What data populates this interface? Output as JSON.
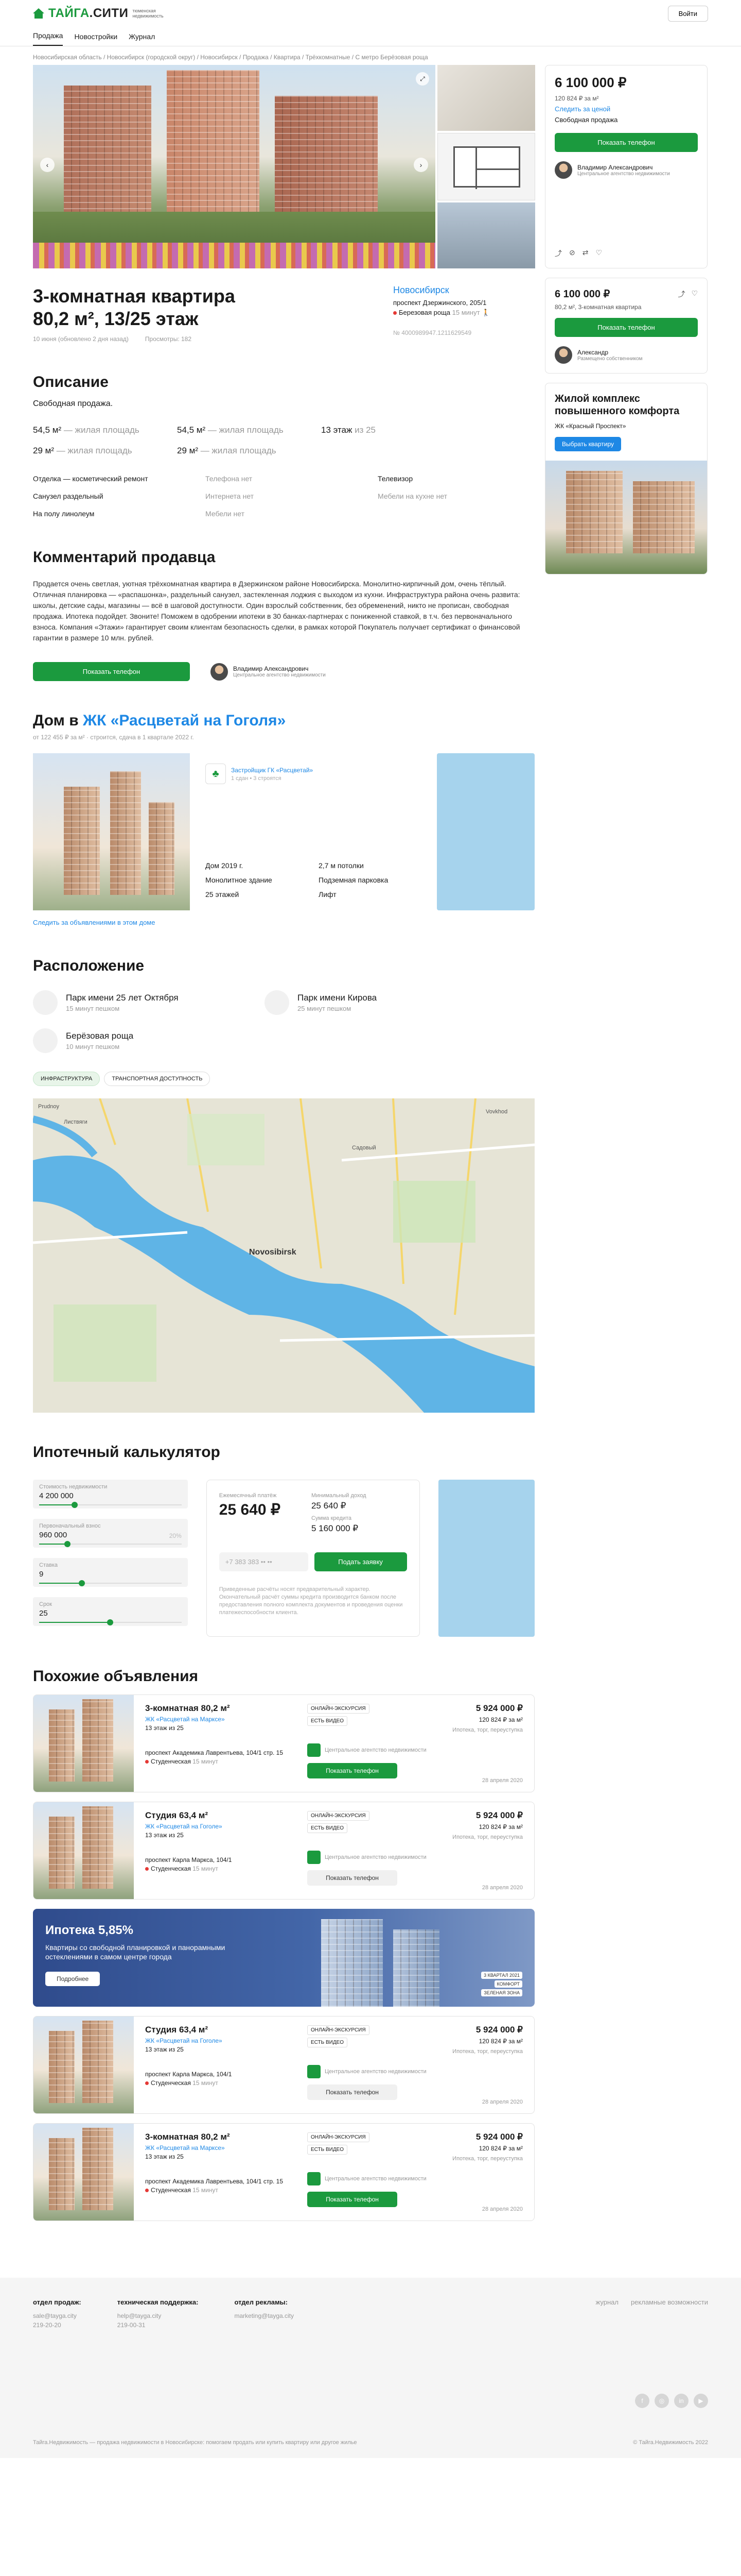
{
  "header": {
    "brand_main": "ТАЙГА",
    "brand_dot": ".СИТИ",
    "brand_sub": "тюменская недвижимость",
    "login": "Войти",
    "nav": [
      "Продажа",
      "Новостройки",
      "Журнал"
    ]
  },
  "breadcrumbs": "Новосибирская область / Новосибирск (городской округ) / Новосибирск / Продажа / Квартира / Трёхкомнатные / С метро Берёзовая роща",
  "price_box": {
    "price": "6 100 000 ₽",
    "ppm": "120 824 ₽ за м²",
    "watch": "Следить за ценой",
    "sale_type": "Свободная продажа",
    "show_phone": "Показать телефон",
    "agent_name": "Владимир Александрович",
    "agent_role": "Центральное агентство недвижимости",
    "icons": [
      "share-icon",
      "block-icon",
      "compare-icon",
      "heart-icon"
    ]
  },
  "listing": {
    "title_line1": "3-комнатная квартира",
    "title_line2": "80,2 м², 13/25 этаж",
    "date": "10 июня (обновлено 2 дня назад)",
    "views": "Просмотры: 182",
    "city": "Новосибирск",
    "street": "проспект Дзержинского, 205/1",
    "metro": "Березовая роща",
    "metro_time": "15 минут",
    "ad_number": "№ 4000989947.1211629549"
  },
  "description": {
    "heading": "Описание",
    "sale": "Свободная продажа.",
    "params": [
      {
        "value": "54,5 м²",
        "label": " — жилая площадь"
      },
      {
        "value": "54,5 м²",
        "label": " — жилая площадь"
      },
      {
        "value": "13 этаж",
        "label": " из 25"
      },
      {
        "value": "29 м²",
        "label": " — жилая площадь"
      },
      {
        "value": "29 м²",
        "label": " — жилая площадь"
      },
      {
        "value": "",
        "label": ""
      }
    ],
    "features": [
      "Отделка — косметический ремонт",
      "Телефона нет",
      "Телевизор",
      "Санузел раздельный",
      "Интернета нет",
      "Мебели на кухне нет",
      "На полу линолеум",
      "Мебели нет",
      ""
    ]
  },
  "comment": {
    "heading": "Комментарий продавца",
    "text": "Продается очень светлая, уютная трёхкомнатная квартира в Дзержинском районе Новосибирска. Монолитно-кирпичный дом, очень тёплый. Отличная планировка — «распашонка», раздельный санузел, застекленная лоджия с выходом из кухни. Инфраструктура района очень развита: школы, детские сады, магазины — всё в шаговой доступности. Один взрослый собственник, без обременений, никто не прописан, свободная продажа. Ипотека подойдет. Звоните! Поможем в одобрении ипотеки в 30 банках-партнерах с пониженной ставкой, в т.ч. без первоначального взноса. Компания «Этажи» гарантирует своим клиентам безопасность сделки, в рамках которой Покупатель получает сертификат о финансовой гарантии в размере 10 млн. рублей.",
    "show_phone": "Показать телефон",
    "agent_name": "Владимир Александрович",
    "agent_role": "Центральное агентство недвижимости"
  },
  "house": {
    "heading_prefix": "Дом в ",
    "heading_link": "ЖК «Расцветай на Гоголя»",
    "sub": "от 122 455 ₽ за м²  ·  строится, сдача в 1 квартале 2022 г.",
    "developer": "Застройщик ГК «Расцветай»",
    "developer_sub": "1 сдан • 3 строятся",
    "facts": [
      "Дом 2019 г.",
      "2,7 м потолки",
      "Монолитное здание",
      "Подземная парковка",
      "25 этажей",
      "Лифт"
    ],
    "follow": "Следить за объявлениями в этом доме"
  },
  "location": {
    "heading": "Расположение",
    "places": [
      {
        "title": "Парк имени 25 лет Октября",
        "time": "15 минут пешком"
      },
      {
        "title": "Парк имени Кирова",
        "time": "25 минут пешком"
      },
      {
        "title": "Берёзовая роща",
        "time": "10 минут пешком"
      }
    ],
    "pills": [
      "ИНФРАСТРУКТУРА",
      "ТРАНСПОРТНАЯ ДОСТУПНОСТЬ"
    ],
    "map_city": "Novosibirsk",
    "map_labels": [
      "Vovkhod",
      "Prudnoy",
      "Листвяги",
      "Садовый"
    ]
  },
  "mortgage": {
    "heading": "Ипотечный калькулятор",
    "fields": [
      {
        "label": "Стоимость недвижимости",
        "value": "4 200 000",
        "hint": "",
        "fill": 0.25
      },
      {
        "label": "Первоначальный взнос",
        "value": "960 000",
        "hint": "20%",
        "fill": 0.2
      },
      {
        "label": "Ставка",
        "value": "9",
        "hint": "",
        "fill": 0.3
      },
      {
        "label": "Срок",
        "value": "25",
        "hint": "",
        "fill": 0.5
      }
    ],
    "monthly_label": "Ежемесячный платёж",
    "monthly": "25 640 ₽",
    "income_label": "Минимальный доход",
    "income": "25 640 ₽",
    "credit_label": "Сумма кредита",
    "credit": "5 160 000 ₽",
    "phone_placeholder": "+7 383 383 •• ••",
    "submit": "Подать заявку",
    "note": "Приведенные расчёты носят предварительный характер. Окончательный расчёт суммы кредита производится банком после предоставления полного комплекта документов и проведения оценки платежеспособности клиента."
  },
  "similar": {
    "heading": "Похожие объявления",
    "items": [
      {
        "title": "3-комнатная 80,2 м²",
        "jk": "ЖК «Расцветай на Марксе»",
        "floor": "13 этаж из 25",
        "addr": "проспект Академика Лаврентьева, 104/1 стр. 15",
        "metro": "Студенческая",
        "metro_time": "15 минут",
        "tags": [
          "ОНЛАЙН-ЭКСКУРСИЯ",
          "ЕСТЬ ВИДЕО"
        ],
        "agent": "Центральное агентство недвижимости",
        "btn": "Показать телефон",
        "btn_style": "g",
        "price": "5 924 000 ₽",
        "ppm": "120 824 ₽ за м²",
        "loc": "Ипотека, торг, переуступка",
        "date": "28 апреля 2020"
      },
      {
        "title": "Студия 63,4 м²",
        "jk": "ЖК «Расцветай на Гоголе»",
        "floor": "13 этаж из 25",
        "addr": "проспект Карла Маркса, 104/1",
        "metro": "Студенческая",
        "metro_time": "15 минут",
        "tags": [
          "ОНЛАЙН-ЭКСКУРСИЯ",
          "ЕСТЬ ВИДЕО"
        ],
        "agent": "Центральное агентство недвижимости",
        "btn": "Показать телефон",
        "btn_style": "gr",
        "price": "5 924 000 ₽",
        "ppm": "120 824 ₽ за м²",
        "loc": "Ипотека, торг, переуступка",
        "date": "28 апреля 2020"
      },
      {
        "title": "Студия 63,4 м²",
        "jk": "ЖК «Расцветай на Гоголе»",
        "floor": "13 этаж из 25",
        "addr": "проспект Карла Маркса, 104/1",
        "metro": "Студенческая",
        "metro_time": "15 минут",
        "tags": [
          "ОНЛАЙН-ЭКСКУРСИЯ",
          "ЕСТЬ ВИДЕО"
        ],
        "agent": "Центральное агентство недвижимости",
        "btn": "Показать телефон",
        "btn_style": "gr",
        "price": "5 924 000 ₽",
        "ppm": "120 824 ₽ за м²",
        "loc": "Ипотека, торг, переуступка",
        "date": "28 апреля 2020"
      },
      {
        "title": "3-комнатная 80,2 м²",
        "jk": "ЖК «Расцветай на Марксе»",
        "floor": "13 этаж из 25",
        "addr": "проспект Академика Лаврентьева, 104/1 стр. 15",
        "metro": "Студенческая",
        "metro_time": "15 минут",
        "tags": [
          "ОНЛАЙН-ЭКСКУРСИЯ",
          "ЕСТЬ ВИДЕО"
        ],
        "agent": "Центральное агентство недвижимости",
        "btn": "Показать телефон",
        "btn_style": "g",
        "price": "5 924 000 ₽",
        "ppm": "120 824 ₽ за м²",
        "loc": "Ипотека, торг, переуступка",
        "date": "28 апреля 2020"
      }
    ],
    "banner": {
      "title": "Ипотека 5,85%",
      "text": "Квартиры со свободной планировкой и панорамными остеклениями в самом центре города",
      "btn": "Подробнее",
      "tags": [
        "3 КВАРТАЛ 2021",
        "КОМФОРТ",
        "ЗЕЛЕНАЯ ЗОНА"
      ]
    }
  },
  "sidebar": {
    "price": "6 100 000 ₽",
    "sub": "80,2 м², 3-комнатная квартира",
    "show_phone": "Показать телефон",
    "agent_name": "Александр",
    "agent_role": "Размещено собственником",
    "jk_title": "Жилой комплекс повышенного комфорта",
    "jk_name": "ЖК «Красный Проспект»",
    "jk_btn": "Выбрать квартиру"
  },
  "footer": {
    "cols": [
      {
        "title": "отдел продаж:",
        "lines": [
          "sale@tayga.city",
          "219-20-20"
        ]
      },
      {
        "title": "техническая поддержка:",
        "lines": [
          "help@tayga.city",
          "219-00-31"
        ]
      },
      {
        "title": "отдел рекламы:",
        "lines": [
          "marketing@tayga.city"
        ]
      }
    ],
    "links": [
      "журнал",
      "рекламные возможности"
    ],
    "social": [
      "f",
      "◎",
      "in",
      "▶"
    ],
    "bottom_left": "Тайга.Недвижимость — продажа недвижимости в Новосибирске: помогаем продать или купить квартиру или другое жилье",
    "bottom_right": "© Тайга.Недвижимость 2022"
  },
  "colors": {
    "accent": "#1b9a3e",
    "link": "#1e88e5"
  }
}
